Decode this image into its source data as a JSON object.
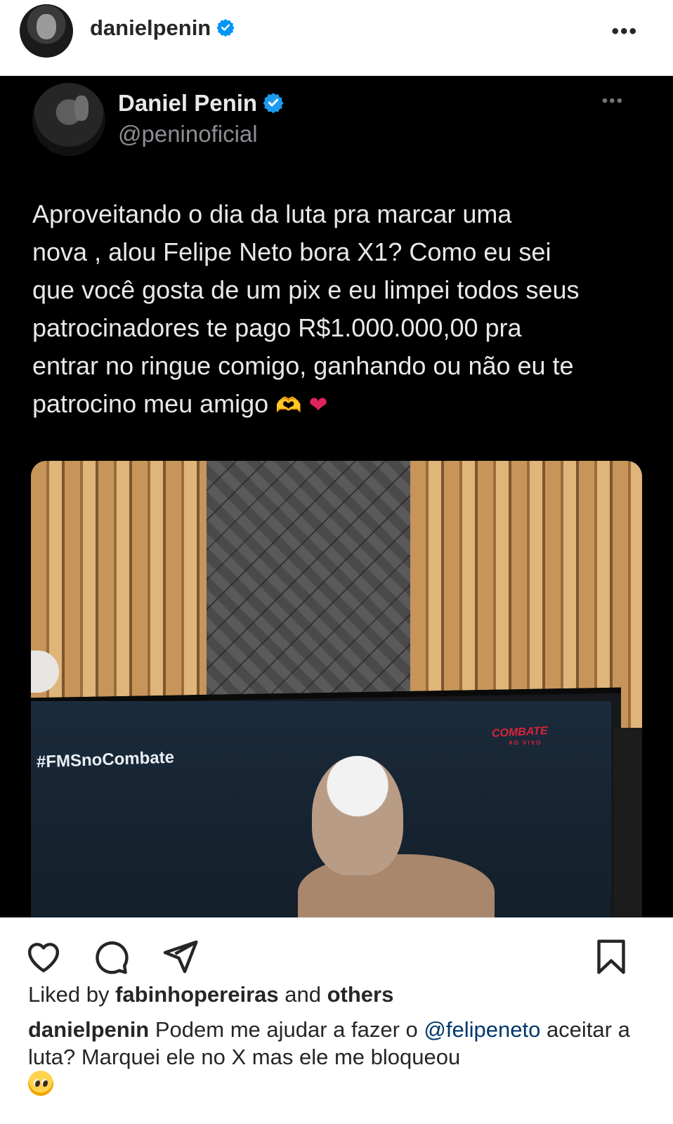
{
  "header": {
    "username": "danielpenin",
    "more_label": "•••"
  },
  "tweet": {
    "display_name": "Daniel Penin",
    "handle": "@peninoficial",
    "more_label": "•••",
    "text_main": "Aproveitando o dia da luta pra marcar uma\nnova , alou Felipe Neto bora X1? Como eu sei\nque você gosta de um pix e eu limpei todos seus\npatrocinadores te pago R$1.000.000,00 pra\nentrar no ringue comigo, ganhando ou não eu te\npatrocino meu amigo ",
    "emoji_hands": "🫶",
    "emoji_heart": "❤",
    "media": {
      "hashtag": "#FMSnoCombate",
      "tv_logo": "COMBATE",
      "tv_logo_sub": "AO VIVO"
    }
  },
  "actions": {
    "like_icon": "heart-outline-icon",
    "comment_icon": "comment-bubble-icon",
    "share_icon": "paper-plane-icon",
    "save_icon": "bookmark-icon"
  },
  "likes": {
    "prefix": "Liked by ",
    "user": "fabinhopereiras",
    "middle": " and ",
    "others": "others"
  },
  "caption": {
    "user": "danielpenin",
    "text_before": " Podem me ajudar a fazer o ",
    "mention": "@felipeneto",
    "text_after": " aceitar a luta? Marquei ele no X mas ele me bloqueou",
    "emoji": "pleading-face-emoji"
  },
  "colors": {
    "verified_blue": "#0095f6",
    "mention_blue": "#00376b",
    "tweet_bg": "#000000",
    "tweet_text": "#e7e9ea",
    "tweet_secondary": "#8b8f93"
  }
}
